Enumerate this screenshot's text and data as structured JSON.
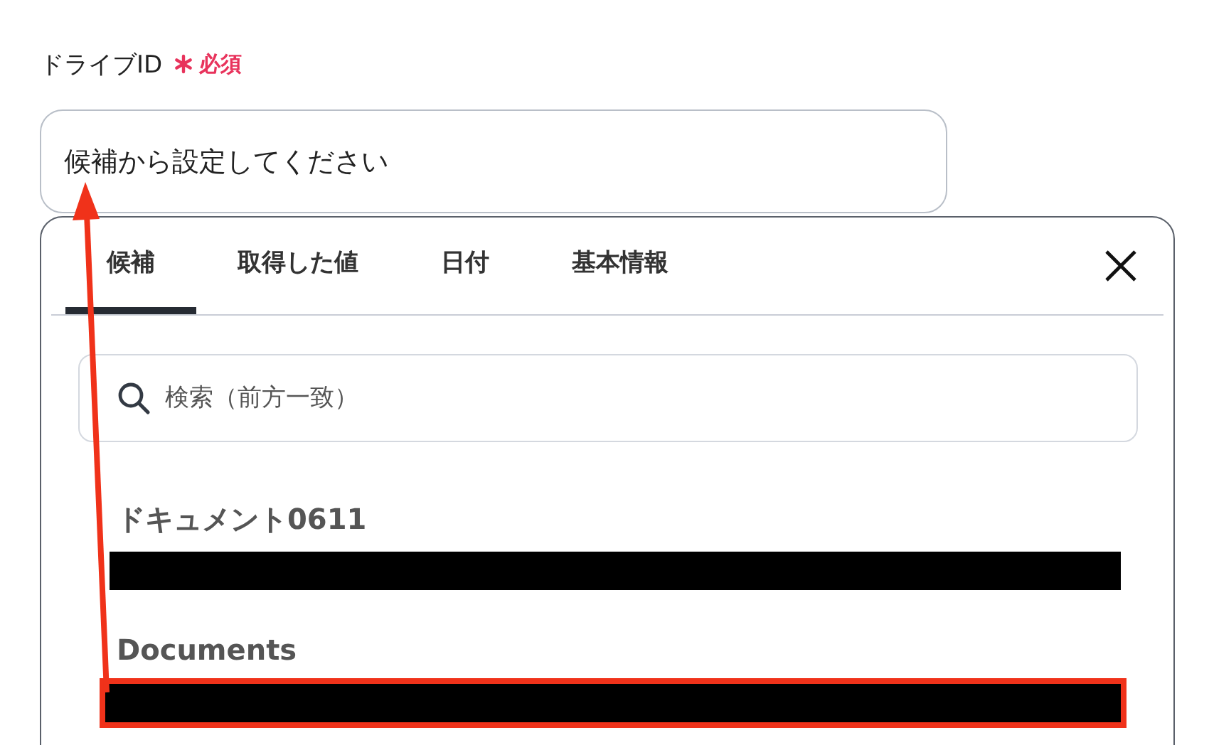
{
  "field": {
    "label": "ドライブID",
    "required": "必須",
    "placeholder": "候補から設定してください"
  },
  "dropdown": {
    "tabs": [
      {
        "label": "候補",
        "selected": true
      },
      {
        "label": "取得した値",
        "selected": false
      },
      {
        "label": "日付",
        "selected": false
      },
      {
        "label": "基本情報",
        "selected": false
      }
    ],
    "search": {
      "placeholder": "検索（前方一致）"
    },
    "items": [
      {
        "title": "ドキュメント0611",
        "highlighted": false
      },
      {
        "title": "Documents",
        "highlighted": true
      }
    ]
  }
}
